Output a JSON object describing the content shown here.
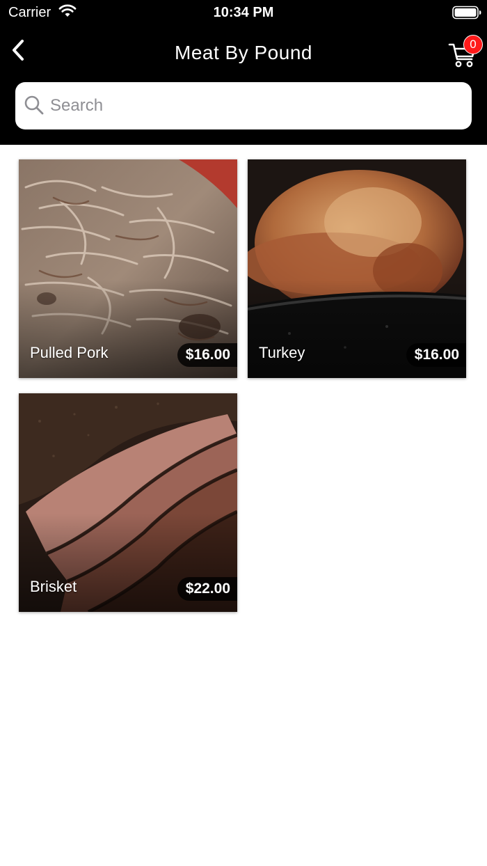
{
  "status_bar": {
    "carrier": "Carrier",
    "time": "10:34 PM",
    "icons": [
      "wifi-icon",
      "battery-icon"
    ]
  },
  "nav": {
    "title": "Meat By Pound",
    "back_icon": "chevron-left-icon",
    "cart_icon": "shopping-cart-icon",
    "cart_count": "0"
  },
  "search": {
    "placeholder": "Search",
    "value": "",
    "icon": "search-icon"
  },
  "colors": {
    "header_bg": "#000000",
    "badge": "#ff1a1a",
    "page_bg": "#ffffff"
  },
  "products": [
    {
      "name": "Pulled Pork",
      "price": "$16.00"
    },
    {
      "name": "Turkey",
      "price": "$16.00"
    },
    {
      "name": "Brisket",
      "price": "$22.00"
    }
  ]
}
